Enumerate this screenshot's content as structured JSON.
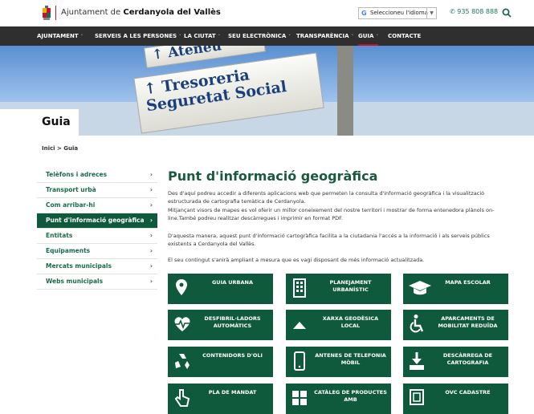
{
  "header": {
    "site_prefix": "Ajuntament de ",
    "site_name": "Cerdanyola del Vallès",
    "lang_label": "Seleccioneu l'idioma",
    "lang_arrow": "▼",
    "phone": "935 808 888"
  },
  "nav": [
    {
      "label": "AJUNTAMENT",
      "caret": true
    },
    {
      "label": "SERVEIS A LES PERSONES",
      "caret": true
    },
    {
      "label": "LA CIUTAT",
      "caret": true
    },
    {
      "label": "SEU ELECTRÒNICA",
      "caret": true
    },
    {
      "label": "TRANSPARÈNCIA",
      "caret": true
    },
    {
      "label": "GUIA",
      "caret": true,
      "active": true
    },
    {
      "label": "CONTACTE",
      "caret": false
    }
  ],
  "hero": {
    "signs": [
      "Ateneu",
      "Tresoreria",
      "Seguretat Social"
    ],
    "title": "Guia"
  },
  "breadcrumb": "Inici > Guia",
  "sidebar": [
    {
      "label": "Telèfons i adreces"
    },
    {
      "label": "Transport urbà"
    },
    {
      "label": "Com arribar-hi"
    },
    {
      "label": "Punt d'informació geogràfica",
      "active": true
    },
    {
      "label": "Entitats"
    },
    {
      "label": "Equipaments"
    },
    {
      "label": "Mercats municipals"
    },
    {
      "label": "Webs municipals"
    }
  ],
  "main": {
    "title": "Punt d'informació geogràfica",
    "p1": "Des d'aquí podreu accedir a diferents aplicacions web que permeten la consulta d'informació geogràfica i la visualització estructurada de cartografia temàtica de Cerdanyola.",
    "p2": "Mitjançant visors de mapes es vol oferir un millor coneixement del nostre territori i mostrar de forma entenedora plànols on-line.També podreu realitzar descàrregues i imprimir en format PDF.",
    "p3": "D'aquesta manera, aquest punt d'informació cartogràfica facilita a la ciutadania l'accés a la informació i als serveis públics existents a Cerdanyola del Vallès.",
    "p4": "El seu contingut s'anirà ampliant a mesura que es vagi disposant de més informació actualitzada."
  },
  "tiles": [
    {
      "label": "GUIA URBANA",
      "icon": "map-pin-icon"
    },
    {
      "label": "PLANEJAMENT URBANÍSTIC",
      "icon": "building-icon"
    },
    {
      "label": "MAPA ESCOLAR",
      "icon": "graduation-cap-icon"
    },
    {
      "label": "DESFIBRIL·LADORS AUTOMÀTICS",
      "icon": "heartbeat-icon"
    },
    {
      "label": "XARXA GEODÈSICA LOCAL",
      "icon": "triangle-icon"
    },
    {
      "label": "APARCAMENTS DE MOBILITAT REDUÏDA",
      "icon": "wheelchair-icon"
    },
    {
      "label": "CONTENIDORS D'OLI",
      "icon": "recycle-icon"
    },
    {
      "label": "ANTENES DE TELEFONIA MÒBIL",
      "icon": "mobile-phone-icon"
    },
    {
      "label": "DESCÀRREGA DE CARTOGRAFIA",
      "icon": "download-icon"
    },
    {
      "label": "PLA DE MANDAT",
      "icon": "hand-pointer-icon"
    },
    {
      "label": "CATÀLEG DE PRODUCTES AMB",
      "icon": "grid-icon"
    },
    {
      "label": "OVC CADASTRE",
      "icon": "frame-icon"
    }
  ]
}
